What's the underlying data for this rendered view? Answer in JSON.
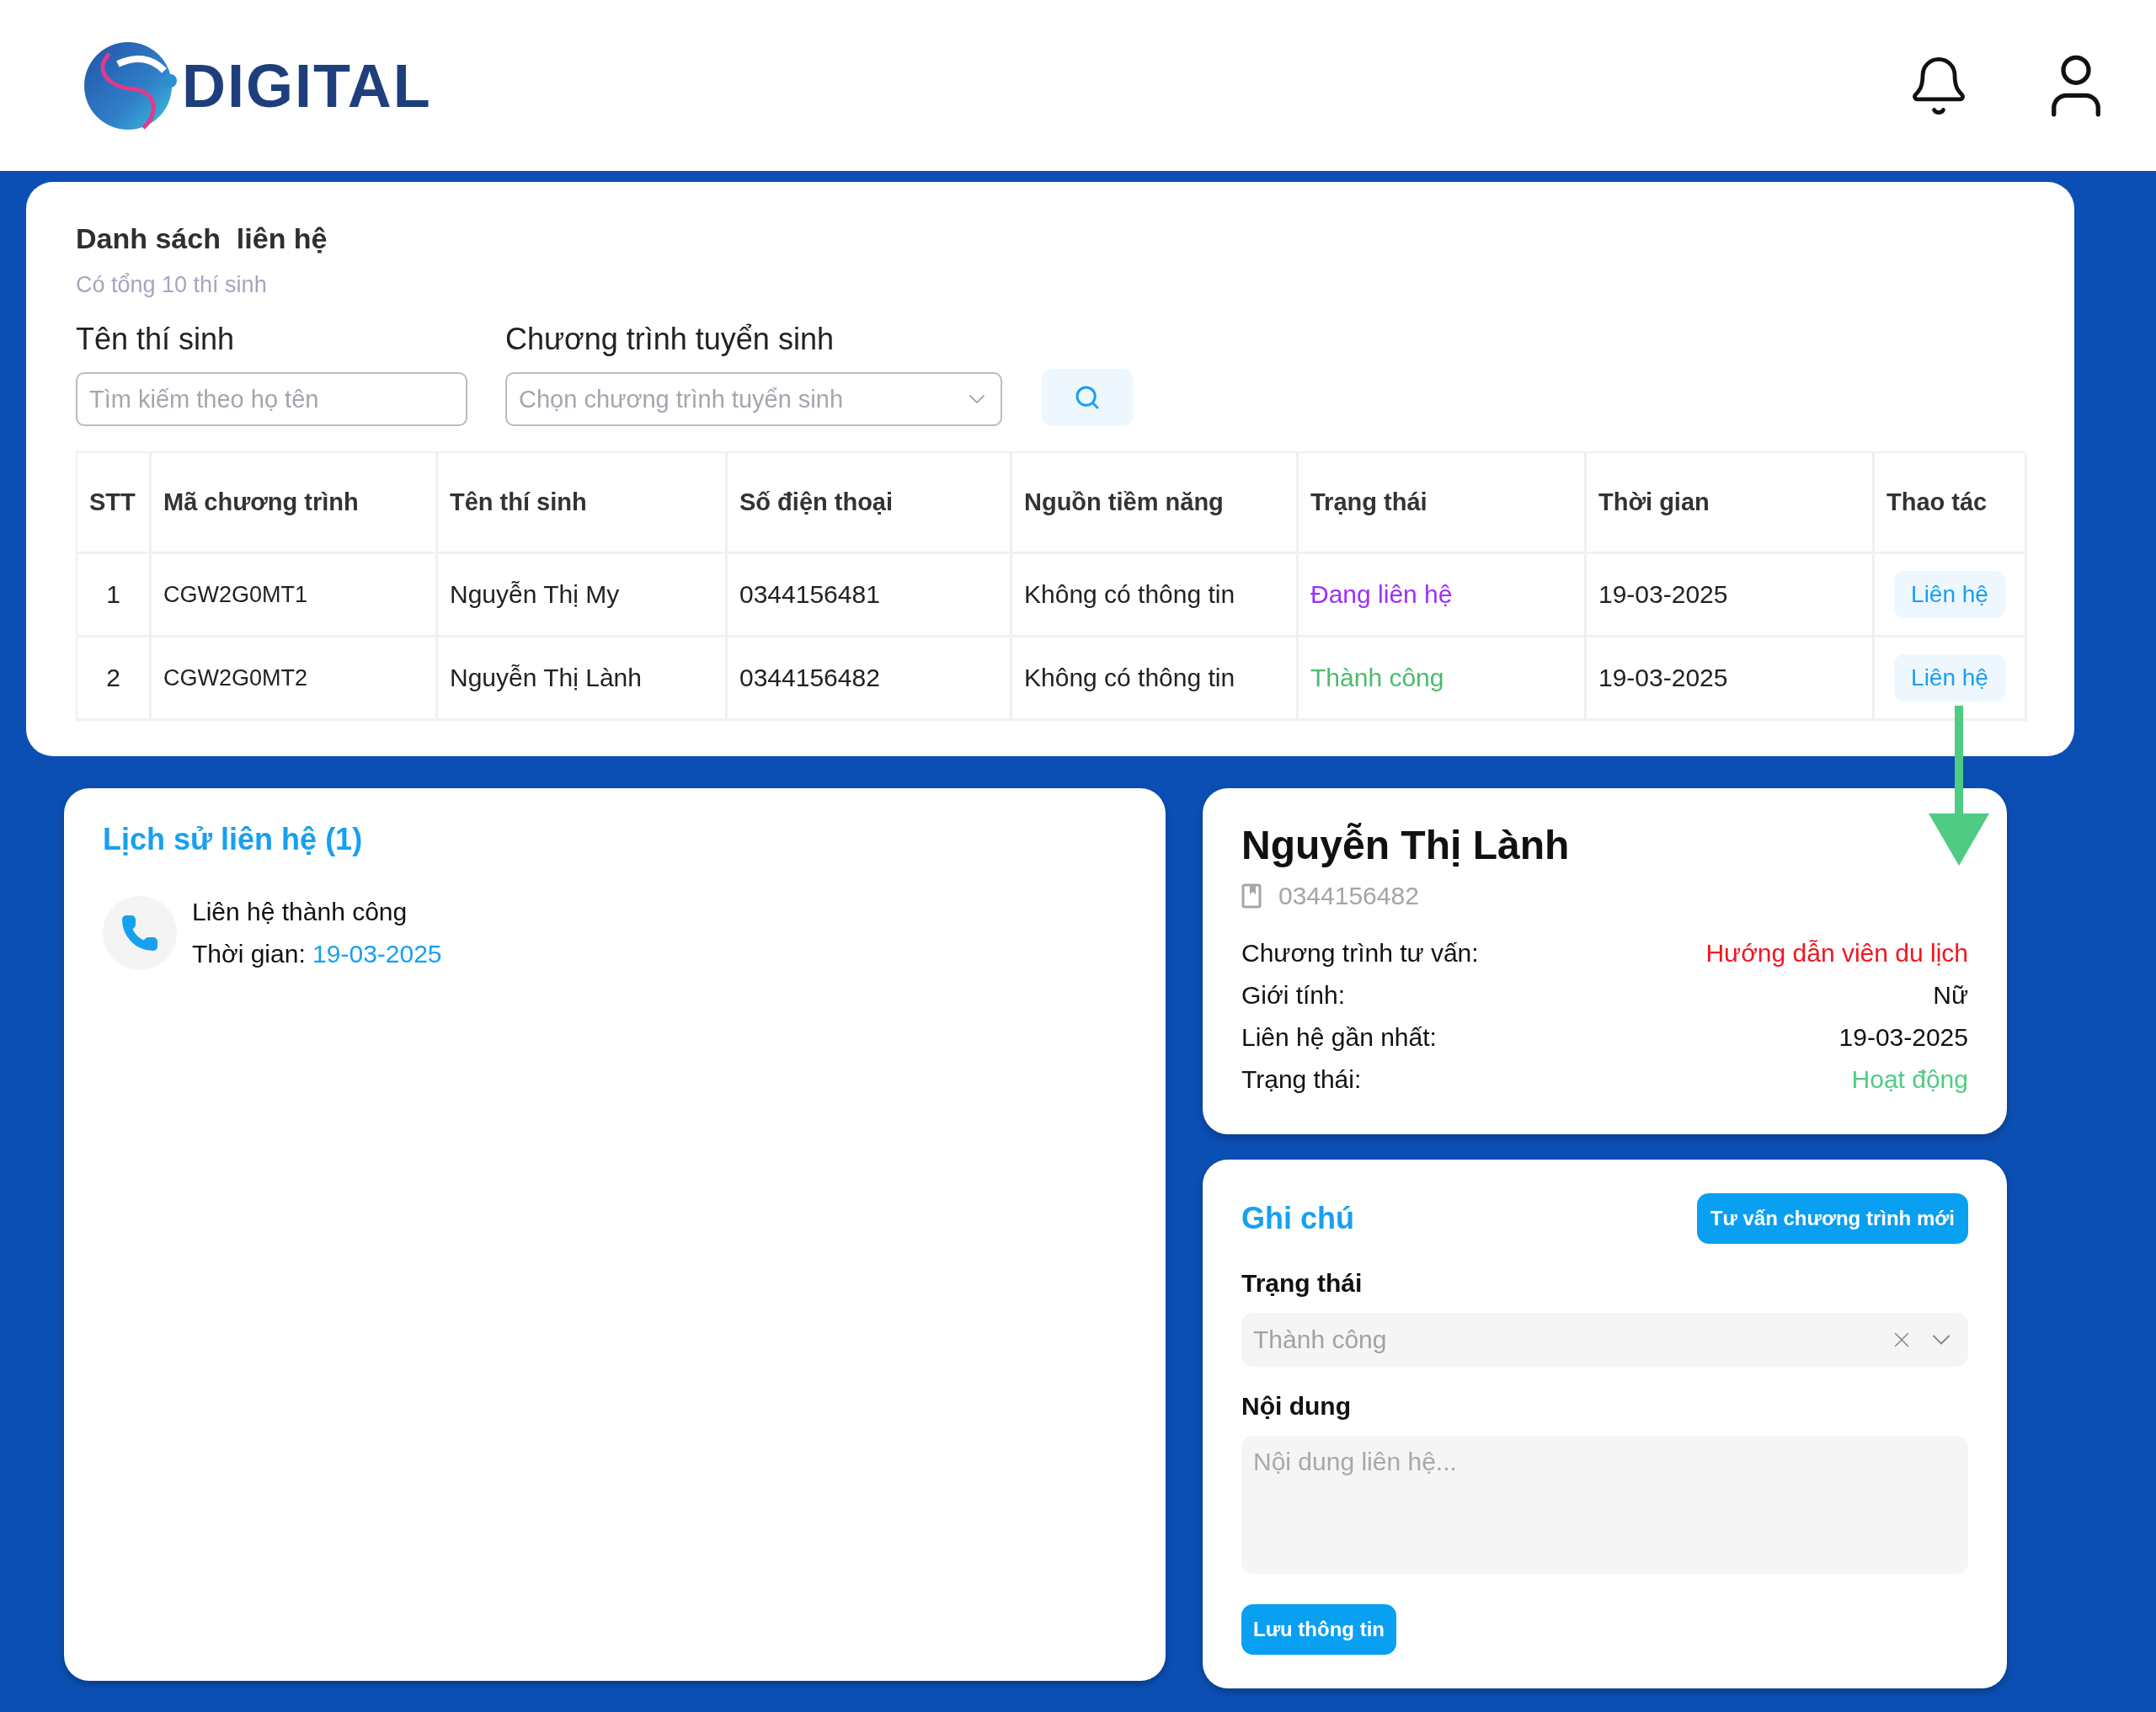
{
  "header": {
    "logo_text": "DIGITAL"
  },
  "contact_list": {
    "title": "Danh sách  liên hệ",
    "subtitle": "Có tổng 10 thí sinh",
    "filters": [
      {
        "kind": "text",
        "label": "Tên thí sinh",
        "placeholder": "Tìm kiếm theo họ tên"
      },
      {
        "kind": "select",
        "label": "Chương trình tuyển sinh",
        "placeholder": "Chọn chương trình tuyển sinh"
      }
    ],
    "table": {
      "columns": [
        "STT",
        "Mã chương trình",
        "Tên thí sinh",
        "Số điện thoại",
        "Nguồn tiềm năng",
        "Trạng thái",
        "Thời gian",
        "Thao tác"
      ],
      "rows": [
        {
          "stt": "1",
          "code": "CGW2G0MT1",
          "name": "Nguyễn Thị My",
          "phone": "0344156481",
          "source": "Không có thông tin",
          "status": "Đang liên hệ",
          "color": "#9b30ff",
          "time": "19-03-2025",
          "action": "Liên hệ"
        },
        {
          "stt": "2",
          "code": "CGW2G0MT2",
          "name": "Nguyễn Thị Lành",
          "phone": "0344156482",
          "source": "Không có thông tin",
          "status": "Thành công",
          "color": "#4cbb6c",
          "time": "19-03-2025",
          "action": "Liên hệ"
        }
      ]
    }
  },
  "history": {
    "title": "Lịch sử liên hệ (1)",
    "entries": [
      {
        "title": "Liên hệ thành công",
        "time_label": "Thời gian:",
        "time": "19-03-2025"
      }
    ]
  },
  "profile": {
    "name": "Nguyễn Thị Lành",
    "phone": "0344156482",
    "fields": [
      {
        "label": "Chương trình tư vấn:",
        "value": "Hướng dẫn viên du lịch",
        "color": "#f5141e"
      },
      {
        "label": "Giới tính:",
        "value": "Nữ",
        "color": "#111111"
      },
      {
        "label": "Liên hệ gần nhất:",
        "value": "19-03-2025",
        "color": "#111111"
      },
      {
        "label": "Trạng thái:",
        "value": "Hoạt động",
        "color": "#4fcb83"
      }
    ]
  },
  "notes": {
    "title": "Ghi chú",
    "new_button": "Tư vấn chương trình mới",
    "status_label": "Trạng thái",
    "status_value": "Thành công",
    "content_label": "Nội dung",
    "content_placeholder": "Nội dung liên hệ...",
    "save_button": "Lưu thông tin"
  }
}
